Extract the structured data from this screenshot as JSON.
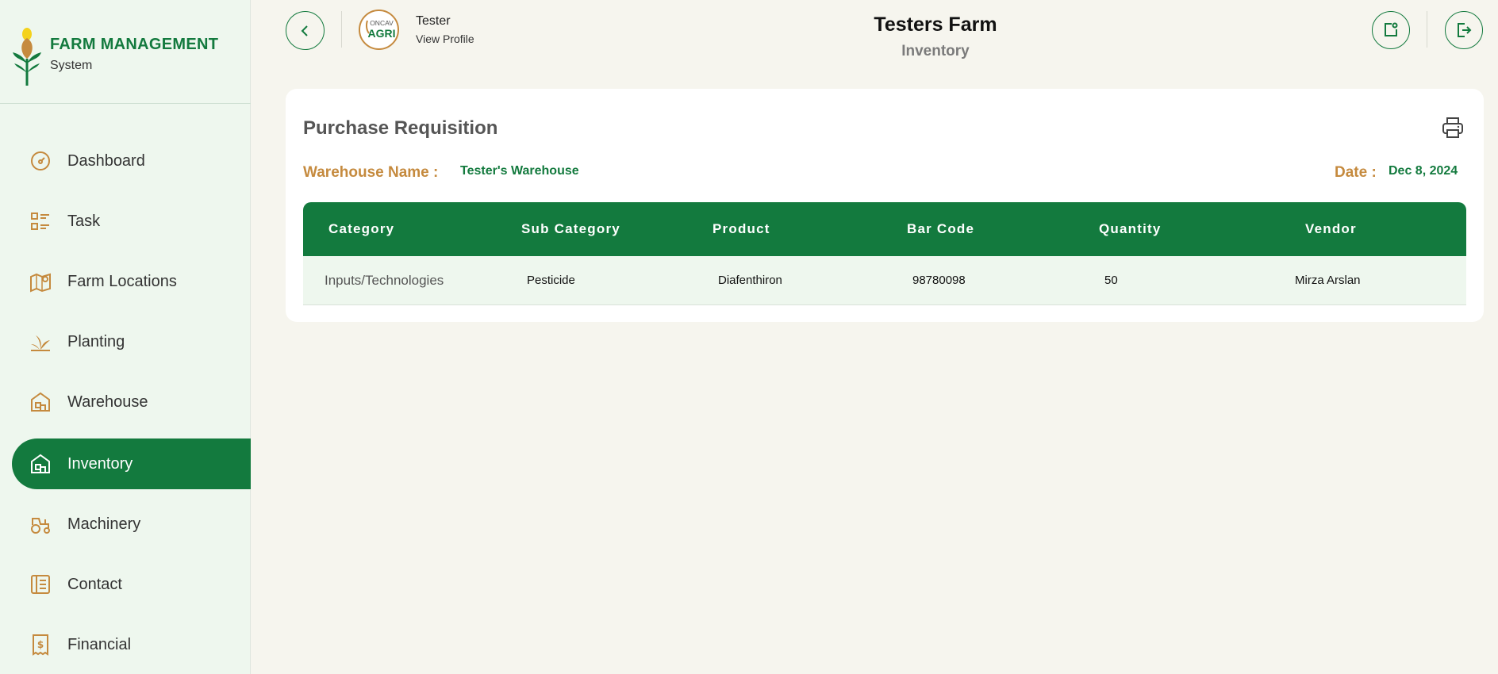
{
  "brand": {
    "title": "FARM MANAGEMENT",
    "subtitle": "System"
  },
  "sidebar": {
    "items": [
      {
        "label": "Dashboard",
        "icon": "dashboard-icon",
        "active": false
      },
      {
        "label": "Task",
        "icon": "task-list-icon",
        "active": false
      },
      {
        "label": "Farm Locations",
        "icon": "map-pin-icon",
        "active": false
      },
      {
        "label": "Planting",
        "icon": "plant-icon",
        "active": false
      },
      {
        "label": "Warehouse",
        "icon": "warehouse-icon",
        "active": false
      },
      {
        "label": "Inventory",
        "icon": "inventory-icon",
        "active": true
      },
      {
        "label": "Machinery",
        "icon": "tractor-icon",
        "active": false
      },
      {
        "label": "Contact",
        "icon": "contact-icon",
        "active": false
      },
      {
        "label": "Financial",
        "icon": "receipt-icon",
        "active": false
      }
    ]
  },
  "header": {
    "user_name": "Tester",
    "view_profile": "View Profile",
    "farm_title": "Testers Farm",
    "page_subtitle": "Inventory",
    "avatar_text_top": "ONCAV",
    "avatar_text_bottom": "AGRI"
  },
  "card": {
    "title": "Purchase Requisition",
    "warehouse_label": "Warehouse Name :",
    "warehouse_value": "Tester's Warehouse",
    "date_label": "Date :",
    "date_value": "Dec 8, 2024"
  },
  "table": {
    "headers": [
      "Category",
      "Sub Category",
      "Product",
      "Bar Code",
      "Quantity",
      "Vendor"
    ],
    "rows": [
      [
        "Inputs/Technologies",
        "Pesticide",
        "Diafenthiron",
        "98780098",
        "50",
        "Mirza Arslan"
      ]
    ]
  },
  "colors": {
    "primary": "#137a3e",
    "accent": "#c58a3e",
    "sidebar_bg": "#eef7ee",
    "page_bg": "#f6f5ee"
  }
}
